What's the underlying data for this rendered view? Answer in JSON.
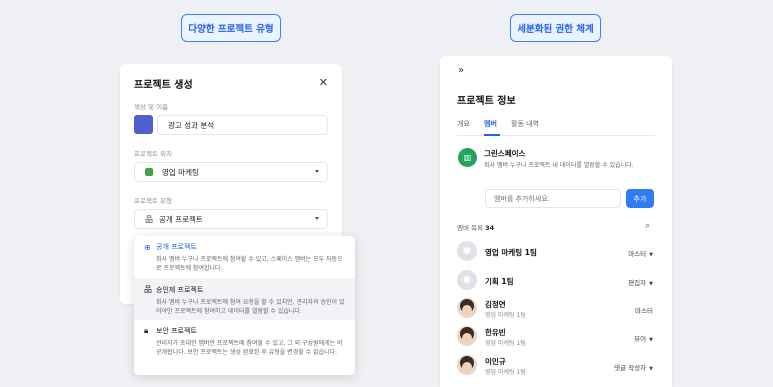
{
  "left_header": "다양한 프로젝트 유형",
  "right_header": "세분화된 권한 체계",
  "create_dialog": {
    "title": "프로젝트 생성",
    "close_icon": "close-icon",
    "color_name_label": "색상 및 이름",
    "project_name": "광고 성과 분석",
    "swatch_color": "#4f5fd1",
    "location_label": "프로젝트 위치",
    "location_value": "영업 마케팅",
    "type_label": "프로젝트 유형",
    "type_value": "공개 프로젝트",
    "options": [
      {
        "icon": "globe-icon",
        "title": "공개 프로젝트",
        "desc": "회사 멤버 누구나 프로젝트에 참여할 수 있고, 스페이스 멤버는 모두 자동으로 프로젝트에 참여합니다."
      },
      {
        "icon": "org-icon",
        "title": "승인제 프로젝트",
        "desc": "회사 멤버 누구나 프로젝트에 참여 요청을 할 수 있지만, 관리자의 승인이 있어야만 프로젝트에 참여하고 데이터를 열람할 수 있습니다."
      },
      {
        "icon": "lock-icon",
        "title": "보안 프로젝트",
        "desc": "관리자가 초대한 멤버만 프로젝트에 참여할 수 있고, 그 외 구성원에게는 비공개됩니다. 보안 프로젝트는 생성 완료된 후 유형을 변경할 수 없습니다."
      }
    ]
  },
  "info_panel": {
    "collapse_icon": "double-chevron-right-icon",
    "title": "프로젝트 정보",
    "tabs": [
      "개요",
      "멤버",
      "활동 내역"
    ],
    "active_tab": "멤버",
    "space_name": "그린스페이스",
    "space_desc": "회사 멤버 누구나 프로젝트 내 데이터를 열람할 수 있습니다.",
    "add_placeholder": "멤버를 추가하세요.",
    "add_button": "추가",
    "member_list_label": "멤버 목록",
    "member_count": "34",
    "members": [
      {
        "name": "영업 마케팅 1팀",
        "sub": "",
        "role": "마스터",
        "dropdown": true,
        "kind": "group"
      },
      {
        "name": "기획 1팀",
        "sub": "",
        "role": "편집자",
        "dropdown": true,
        "kind": "group"
      },
      {
        "name": "김정연",
        "sub": "영업 마케팅 1팀",
        "role": "마스터",
        "dropdown": false,
        "kind": "person"
      },
      {
        "name": "한유빈",
        "sub": "영업 마케팅 1팀",
        "role": "뷰어",
        "dropdown": true,
        "kind": "person"
      },
      {
        "name": "이민규",
        "sub": "영업 마케팅 1팀",
        "role": "댓글 작성자",
        "dropdown": true,
        "kind": "person"
      }
    ]
  }
}
